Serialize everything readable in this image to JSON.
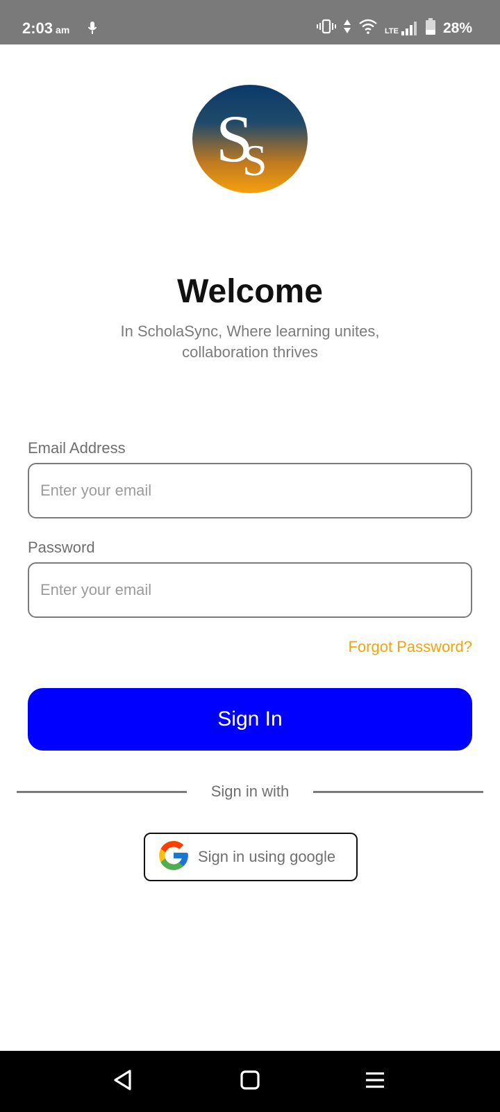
{
  "status_bar": {
    "time": "2:03",
    "ampm": "am",
    "network": "LTE",
    "battery": "28%"
  },
  "app": {
    "welcome_title": "Welcome",
    "tagline": "In ScholaSync, Where learning unites, collaboration thrives"
  },
  "form": {
    "email_label": "Email Address",
    "email_placeholder": "Enter your email",
    "password_label": "Password",
    "password_placeholder": "Enter your email",
    "forgot_link": "Forgot Password?",
    "signin_button": "Sign In"
  },
  "social": {
    "divider_text": "Sign in with",
    "google_button": "Sign in using google"
  },
  "colors": {
    "primary_button": "#0000ff",
    "accent_link": "#f5a30a",
    "status_bar": "#7a7a7a"
  },
  "icons": [
    "mic-icon",
    "vibrate-icon",
    "data-arrows-icon",
    "wifi-icon",
    "signal-icon",
    "battery-icon",
    "google-icon",
    "back-icon",
    "home-icon",
    "menu-icon"
  ]
}
